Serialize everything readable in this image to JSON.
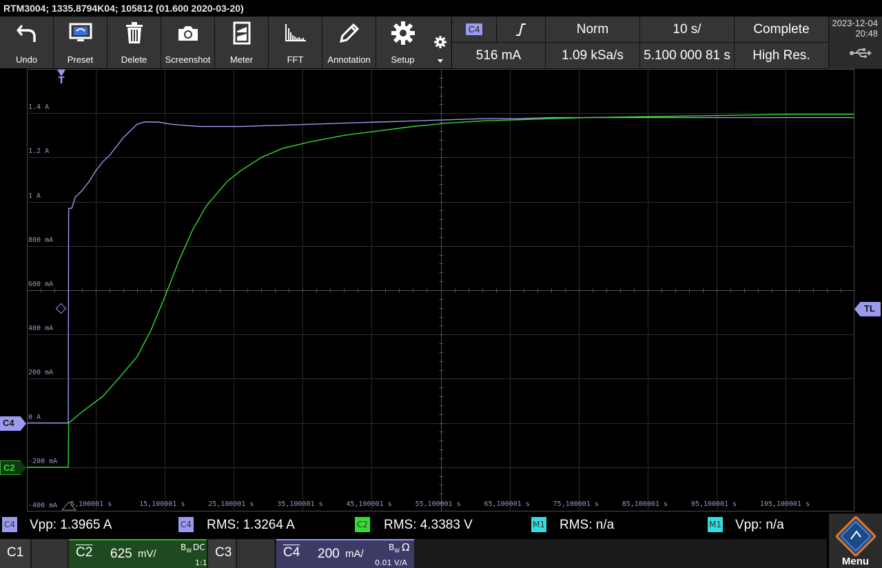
{
  "titlebar": {
    "text": "RTM3004; 1335.8794K04; 105812 (01.600 2020-03-20)"
  },
  "toolbar": {
    "undo": "Undo",
    "preset": "Preset",
    "delete": "Delete",
    "screenshot": "Screenshot",
    "meter": "Meter",
    "fft": "FFT",
    "annotation": "Annotation",
    "setup": "Setup"
  },
  "trigger": {
    "source": "C4",
    "slope_icon": "rising-edge-icon",
    "mode": "Norm",
    "level": "516 mA",
    "sample_rate": "1.09 kSa/s"
  },
  "timebase": {
    "scale": "10 s/",
    "position": "5.100 000 81 s"
  },
  "acquisition": {
    "state": "Complete",
    "mode": "High Res."
  },
  "datetime": {
    "date": "2023-12-04",
    "time": "20:48"
  },
  "y_labels": [
    "1.4 A",
    "1.2 A",
    "1 A",
    "800 mA",
    "600 mA",
    "400 mA",
    "200 mA",
    "0 A",
    "-200 mA",
    "-400 mA"
  ],
  "x_labels": [
    "5,100001 s",
    "15,100001 s",
    "25,100001 s",
    "35,100001 s",
    "45,100001 s",
    "55,100001 s",
    "65,100001 s",
    "75,100001 s",
    "85,100001 s",
    "95,100001 s",
    "105,100001 s"
  ],
  "markers": {
    "trigger": "T",
    "trigger_level": "TL",
    "c4": "C4",
    "c2": "C2"
  },
  "measurements": [
    {
      "badge": "C4",
      "text": "Vpp: 1.3965 A",
      "color": "#9a9aee"
    },
    {
      "badge": "C4",
      "text": "RMS: 1.3264 A",
      "color": "#9a9aee"
    },
    {
      "badge": "C2",
      "text": "RMS: 4.3383 V",
      "color": "#33dd33"
    },
    {
      "badge": "M1",
      "text": "RMS: n/a",
      "color": "#33dddd"
    },
    {
      "badge": "M1",
      "text": "Vpp: n/a",
      "color": "#33dddd"
    }
  ],
  "channels": {
    "c1": {
      "name": "C1"
    },
    "c2": {
      "name": "C2",
      "scale": "625",
      "unit": "mV/",
      "coupling": "DC",
      "bw": "B",
      "bw_sub": "W",
      "probe": "1:1"
    },
    "c3": {
      "name": "C3"
    },
    "c4": {
      "name": "C4",
      "scale": "200",
      "unit": "mA/",
      "coupling": "Ω",
      "bw": "B",
      "bw_sub": "W",
      "probe": "0.01 V/A"
    }
  },
  "menu": {
    "label": "Menu"
  },
  "colors": {
    "ch4": "#9a9aee",
    "ch2": "#33dd33",
    "grid": "#2e2e2e",
    "toolbar": "#353535"
  },
  "chart_data": {
    "type": "line",
    "ylim": [
      -0.4,
      1.6
    ],
    "xlim": [
      -1.0,
      119.0
    ],
    "x_tick_values": [
      5.1,
      15.1,
      25.1,
      35.1,
      45.1,
      55.1,
      65.1,
      75.1,
      85.1,
      95.1,
      105.1
    ],
    "y_tick_values": [
      1.4,
      1.2,
      1.0,
      0.8,
      0.6,
      0.4,
      0.2,
      0.0,
      -0.2,
      -0.4
    ],
    "series": [
      {
        "name": "C4",
        "x": [
          -1.0,
          5.0,
          5.05,
          5.5,
          6,
          7,
          8,
          9,
          10,
          11,
          12,
          13,
          14,
          15,
          16,
          17,
          18,
          20,
          22,
          24,
          26,
          28,
          30,
          35,
          40,
          45,
          50,
          55,
          60,
          65,
          70,
          75,
          80,
          85,
          90,
          95,
          100,
          105,
          110,
          115,
          119
        ],
        "y": [
          0.0,
          0.0,
          0.97,
          0.97,
          1.02,
          1.05,
          1.09,
          1.14,
          1.18,
          1.21,
          1.25,
          1.29,
          1.32,
          1.35,
          1.36,
          1.36,
          1.36,
          1.35,
          1.345,
          1.34,
          1.34,
          1.34,
          1.34,
          1.345,
          1.35,
          1.355,
          1.36,
          1.365,
          1.37,
          1.375,
          1.375,
          1.38,
          1.38,
          1.38,
          1.38,
          1.38,
          1.38,
          1.38,
          1.38,
          1.38,
          1.38
        ]
      },
      {
        "name": "C2",
        "x": [
          -1.0,
          5.0,
          5.05,
          7,
          10,
          12,
          15,
          17,
          19,
          21,
          23,
          25,
          28,
          30,
          33,
          36,
          40,
          45,
          50,
          55,
          60,
          65,
          70,
          75,
          80,
          90,
          100,
          110,
          119
        ],
        "y": [
          -0.2,
          -0.2,
          0.0,
          0.05,
          0.12,
          0.19,
          0.3,
          0.42,
          0.57,
          0.73,
          0.87,
          0.98,
          1.09,
          1.14,
          1.2,
          1.24,
          1.27,
          1.3,
          1.32,
          1.34,
          1.355,
          1.365,
          1.37,
          1.375,
          1.38,
          1.385,
          1.39,
          1.395,
          1.395
        ]
      }
    ]
  }
}
